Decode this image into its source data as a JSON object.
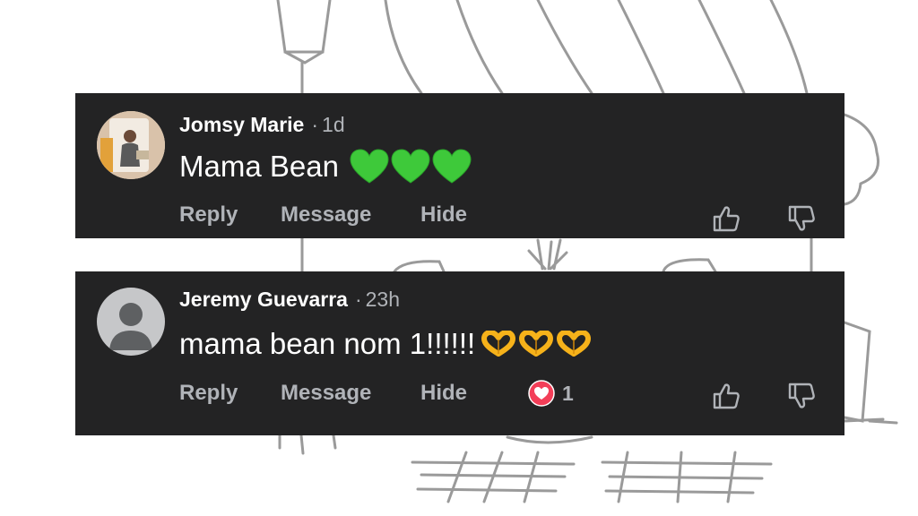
{
  "comments": [
    {
      "author": "Jomsy Marie",
      "separator": "·",
      "time": "1d",
      "text": "Mama Bean",
      "emojis": [
        "green-heart",
        "green-heart",
        "green-heart"
      ],
      "actions": {
        "reply": "Reply",
        "message": "Message",
        "hide": "Hide"
      },
      "avatar": "profile-photo",
      "reactions": null
    },
    {
      "author": "Jeremy Guevarra",
      "separator": "·",
      "time": "23h",
      "text": "mama bean nom 1!!!!!!",
      "emojis": [
        "heart-hands",
        "heart-hands",
        "heart-hands"
      ],
      "actions": {
        "reply": "Reply",
        "message": "Message",
        "hide": "Hide"
      },
      "avatar": "default-avatar",
      "reactions": {
        "type": "love",
        "count": "1"
      }
    }
  ],
  "colors": {
    "card_bg": "#232324",
    "text": "#ffffff",
    "muted": "#b0b3b8",
    "green_heart": "#3ec93a",
    "love_reaction": "#f33e58",
    "heart_hands": "#f6b21a"
  }
}
